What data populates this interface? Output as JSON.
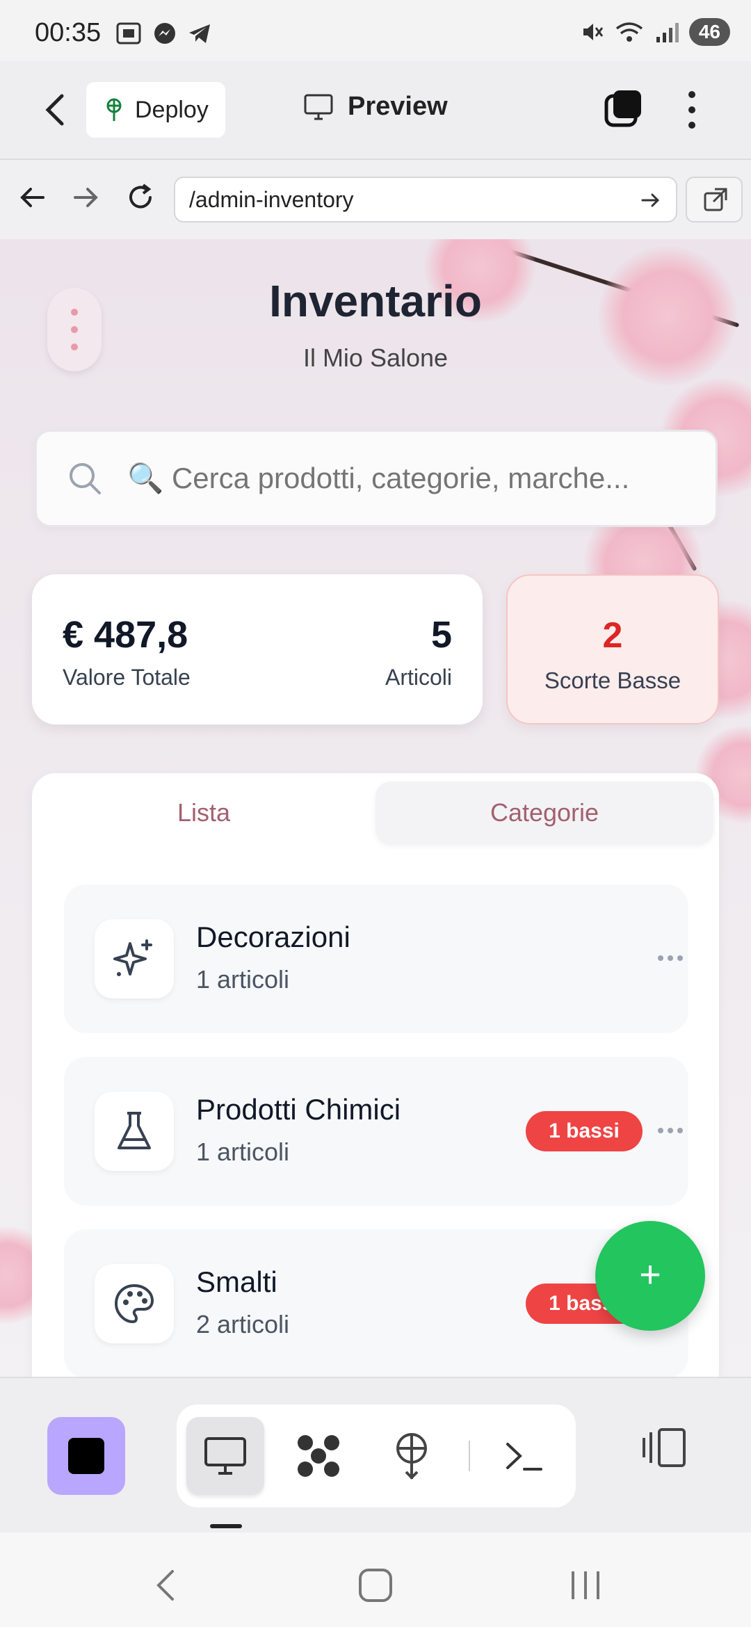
{
  "status_bar": {
    "time": "00:35",
    "battery": "46",
    "icons_left": [
      "screenshot-icon",
      "messenger-icon",
      "telegram-icon"
    ],
    "icons_right": [
      "mute-icon",
      "wifi-icon",
      "signal-icon"
    ]
  },
  "app_bar": {
    "deploy_label": "Deploy",
    "preview_label": "Preview"
  },
  "url_bar": {
    "url": "/admin-inventory"
  },
  "page": {
    "title": "Inventario",
    "subtitle": "Il Mio Salone",
    "search_placeholder": "🔍 Cerca prodotti, categorie, marche..."
  },
  "stats": {
    "total_value": "€ 487,8",
    "total_value_label": "Valore Totale",
    "items_count": "5",
    "items_label": "Articoli",
    "low_stock_count": "2",
    "low_stock_label": "Scorte Basse"
  },
  "tabs": {
    "list": "Lista",
    "categories": "Categorie",
    "active": "categories"
  },
  "categories": [
    {
      "name": "Decorazioni",
      "count": "1 articoli",
      "badge": "",
      "icon": "sparkles-icon"
    },
    {
      "name": "Prodotti Chimici",
      "count": "1 articoli",
      "badge": "1 bassi",
      "icon": "flask-icon"
    },
    {
      "name": "Smalti",
      "count": "2 articoli",
      "badge": "1 bassi",
      "icon": "palette-icon"
    }
  ],
  "fab": {
    "label": "+"
  },
  "colors": {
    "accent_green": "#22c55e",
    "danger_red": "#ef4444",
    "tab_text": "#a3606f",
    "purple_button": "#b9a6ff"
  }
}
